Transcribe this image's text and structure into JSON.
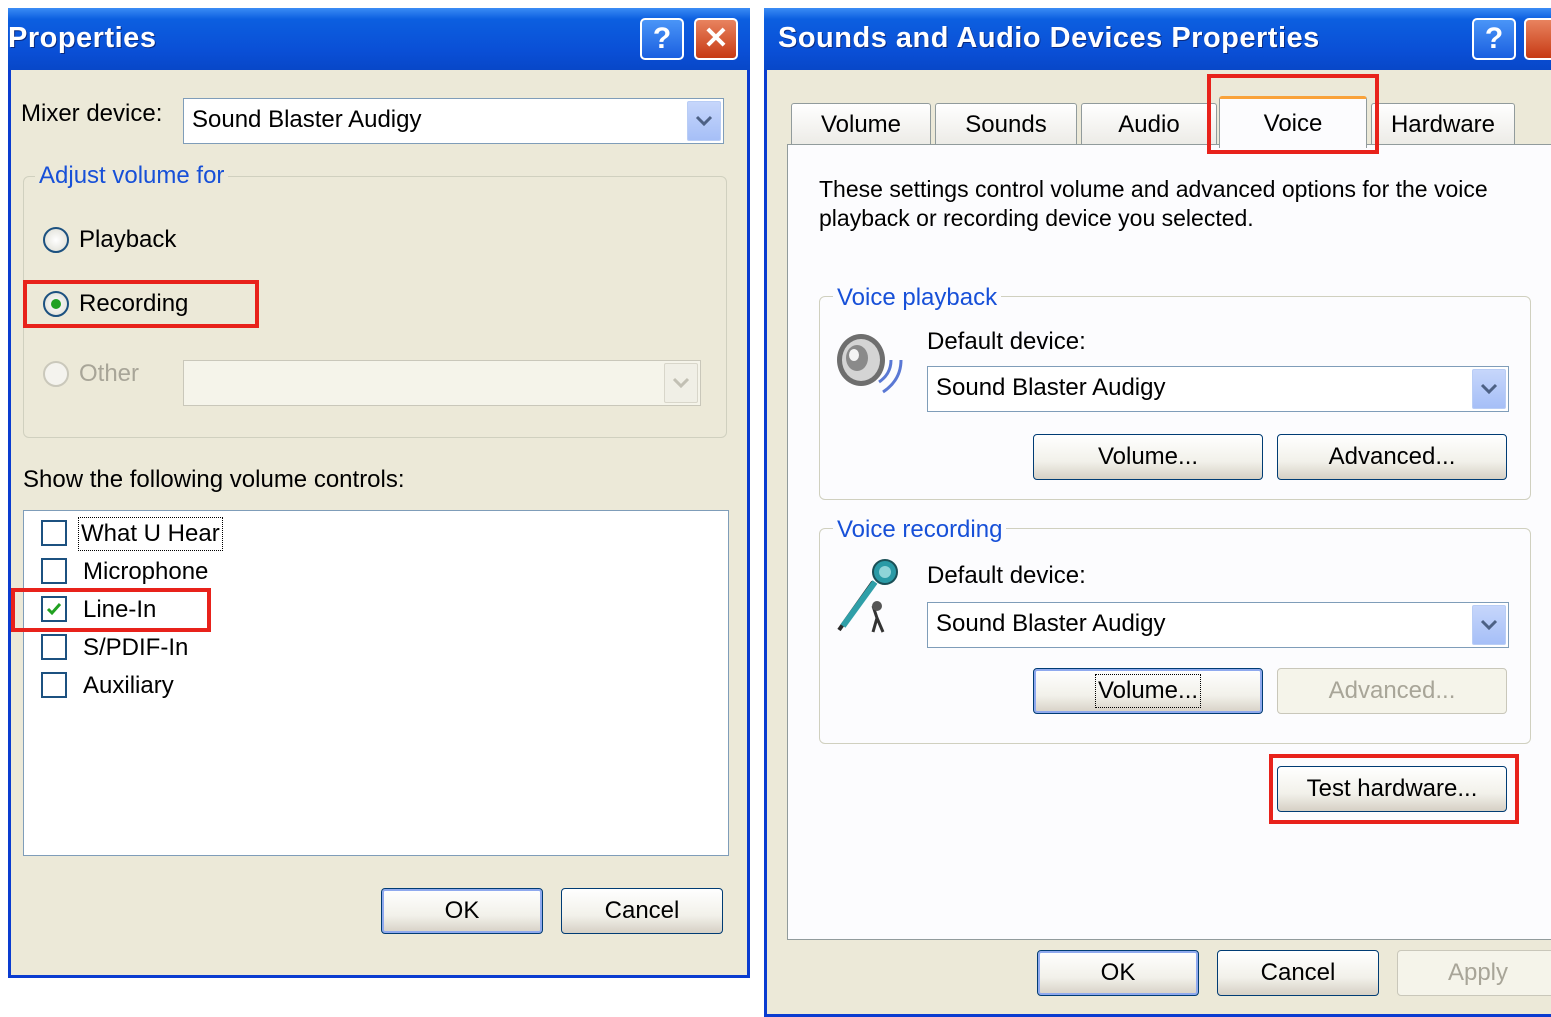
{
  "left_dialog": {
    "title": "Properties",
    "help_button": "?",
    "close_button": "✕",
    "mixer_device_label": "Mixer device:",
    "mixer_device_value": "Sound Blaster Audigy",
    "adjust_volume_for": "Adjust volume for",
    "radio_playback": "Playback",
    "radio_recording": "Recording",
    "radio_other": "Other",
    "radio_selected": "Recording",
    "other_combo_value": "",
    "show_controls_label": "Show the following volume controls:",
    "controls": [
      {
        "label": "What U Hear",
        "checked": false
      },
      {
        "label": "Microphone",
        "checked": false
      },
      {
        "label": "Line-In",
        "checked": true
      },
      {
        "label": "S/PDIF-In",
        "checked": false
      },
      {
        "label": "Auxiliary",
        "checked": false
      }
    ],
    "ok_label": "OK",
    "cancel_label": "Cancel"
  },
  "right_dialog": {
    "title": "Sounds and Audio Devices Properties",
    "help_button": "?",
    "tabs": [
      "Volume",
      "Sounds",
      "Audio",
      "Voice",
      "Hardware"
    ],
    "active_tab": "Voice",
    "description": "These settings control volume and advanced options for the voice playback or recording device you selected.",
    "description_line1": "These settings control volume and advanced options for the voice",
    "description_line2": "playback or recording device you selected.",
    "voice_playback": {
      "legend": "Voice playback",
      "default_device_label": "Default device:",
      "device": "Sound Blaster Audigy",
      "volume_button": "Volume...",
      "advanced_button": "Advanced...",
      "icon": "speaker-icon"
    },
    "voice_recording": {
      "legend": "Voice recording",
      "default_device_label": "Default device:",
      "device": "Sound Blaster Audigy",
      "volume_button": "Volume...",
      "advanced_button": "Advanced...",
      "advanced_disabled": true,
      "icon": "microphone-icon"
    },
    "test_hardware_button": "Test hardware...",
    "ok_label": "OK",
    "cancel_label": "Cancel",
    "apply_label": "Apply",
    "apply_disabled": true
  },
  "colors": {
    "highlight_box": "#e8221b",
    "titlebar": "#0a4fd6",
    "group_legend": "#1750d8",
    "dialog_bg": "#ece9d8"
  }
}
